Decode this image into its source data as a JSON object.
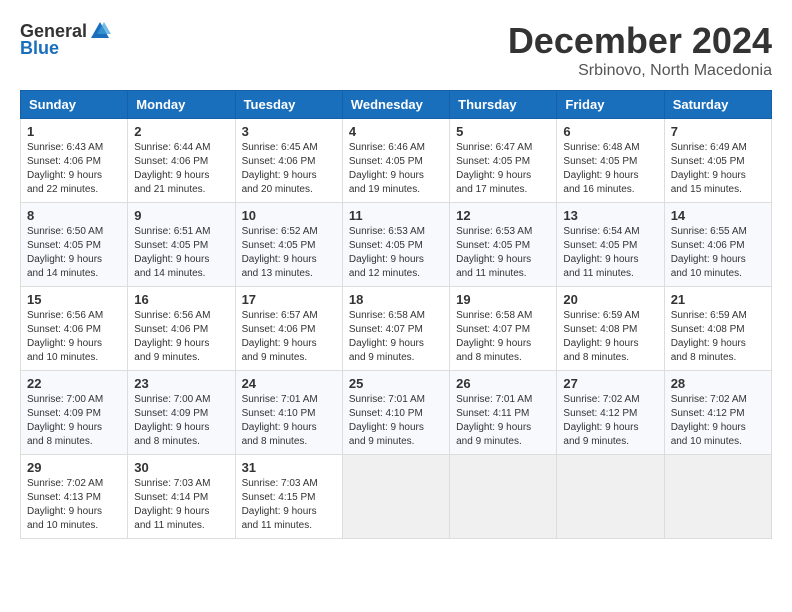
{
  "header": {
    "logo_general": "General",
    "logo_blue": "Blue",
    "month_title": "December 2024",
    "subtitle": "Srbinovo, North Macedonia"
  },
  "weekdays": [
    "Sunday",
    "Monday",
    "Tuesday",
    "Wednesday",
    "Thursday",
    "Friday",
    "Saturday"
  ],
  "weeks": [
    [
      {
        "day": "1",
        "sunrise": "Sunrise: 6:43 AM",
        "sunset": "Sunset: 4:06 PM",
        "daylight": "Daylight: 9 hours and 22 minutes."
      },
      {
        "day": "2",
        "sunrise": "Sunrise: 6:44 AM",
        "sunset": "Sunset: 4:06 PM",
        "daylight": "Daylight: 9 hours and 21 minutes."
      },
      {
        "day": "3",
        "sunrise": "Sunrise: 6:45 AM",
        "sunset": "Sunset: 4:06 PM",
        "daylight": "Daylight: 9 hours and 20 minutes."
      },
      {
        "day": "4",
        "sunrise": "Sunrise: 6:46 AM",
        "sunset": "Sunset: 4:05 PM",
        "daylight": "Daylight: 9 hours and 19 minutes."
      },
      {
        "day": "5",
        "sunrise": "Sunrise: 6:47 AM",
        "sunset": "Sunset: 4:05 PM",
        "daylight": "Daylight: 9 hours and 17 minutes."
      },
      {
        "day": "6",
        "sunrise": "Sunrise: 6:48 AM",
        "sunset": "Sunset: 4:05 PM",
        "daylight": "Daylight: 9 hours and 16 minutes."
      },
      {
        "day": "7",
        "sunrise": "Sunrise: 6:49 AM",
        "sunset": "Sunset: 4:05 PM",
        "daylight": "Daylight: 9 hours and 15 minutes."
      }
    ],
    [
      {
        "day": "8",
        "sunrise": "Sunrise: 6:50 AM",
        "sunset": "Sunset: 4:05 PM",
        "daylight": "Daylight: 9 hours and 14 minutes."
      },
      {
        "day": "9",
        "sunrise": "Sunrise: 6:51 AM",
        "sunset": "Sunset: 4:05 PM",
        "daylight": "Daylight: 9 hours and 14 minutes."
      },
      {
        "day": "10",
        "sunrise": "Sunrise: 6:52 AM",
        "sunset": "Sunset: 4:05 PM",
        "daylight": "Daylight: 9 hours and 13 minutes."
      },
      {
        "day": "11",
        "sunrise": "Sunrise: 6:53 AM",
        "sunset": "Sunset: 4:05 PM",
        "daylight": "Daylight: 9 hours and 12 minutes."
      },
      {
        "day": "12",
        "sunrise": "Sunrise: 6:53 AM",
        "sunset": "Sunset: 4:05 PM",
        "daylight": "Daylight: 9 hours and 11 minutes."
      },
      {
        "day": "13",
        "sunrise": "Sunrise: 6:54 AM",
        "sunset": "Sunset: 4:05 PM",
        "daylight": "Daylight: 9 hours and 11 minutes."
      },
      {
        "day": "14",
        "sunrise": "Sunrise: 6:55 AM",
        "sunset": "Sunset: 4:06 PM",
        "daylight": "Daylight: 9 hours and 10 minutes."
      }
    ],
    [
      {
        "day": "15",
        "sunrise": "Sunrise: 6:56 AM",
        "sunset": "Sunset: 4:06 PM",
        "daylight": "Daylight: 9 hours and 10 minutes."
      },
      {
        "day": "16",
        "sunrise": "Sunrise: 6:56 AM",
        "sunset": "Sunset: 4:06 PM",
        "daylight": "Daylight: 9 hours and 9 minutes."
      },
      {
        "day": "17",
        "sunrise": "Sunrise: 6:57 AM",
        "sunset": "Sunset: 4:06 PM",
        "daylight": "Daylight: 9 hours and 9 minutes."
      },
      {
        "day": "18",
        "sunrise": "Sunrise: 6:58 AM",
        "sunset": "Sunset: 4:07 PM",
        "daylight": "Daylight: 9 hours and 9 minutes."
      },
      {
        "day": "19",
        "sunrise": "Sunrise: 6:58 AM",
        "sunset": "Sunset: 4:07 PM",
        "daylight": "Daylight: 9 hours and 8 minutes."
      },
      {
        "day": "20",
        "sunrise": "Sunrise: 6:59 AM",
        "sunset": "Sunset: 4:08 PM",
        "daylight": "Daylight: 9 hours and 8 minutes."
      },
      {
        "day": "21",
        "sunrise": "Sunrise: 6:59 AM",
        "sunset": "Sunset: 4:08 PM",
        "daylight": "Daylight: 9 hours and 8 minutes."
      }
    ],
    [
      {
        "day": "22",
        "sunrise": "Sunrise: 7:00 AM",
        "sunset": "Sunset: 4:09 PM",
        "daylight": "Daylight: 9 hours and 8 minutes."
      },
      {
        "day": "23",
        "sunrise": "Sunrise: 7:00 AM",
        "sunset": "Sunset: 4:09 PM",
        "daylight": "Daylight: 9 hours and 8 minutes."
      },
      {
        "day": "24",
        "sunrise": "Sunrise: 7:01 AM",
        "sunset": "Sunset: 4:10 PM",
        "daylight": "Daylight: 9 hours and 8 minutes."
      },
      {
        "day": "25",
        "sunrise": "Sunrise: 7:01 AM",
        "sunset": "Sunset: 4:10 PM",
        "daylight": "Daylight: 9 hours and 9 minutes."
      },
      {
        "day": "26",
        "sunrise": "Sunrise: 7:01 AM",
        "sunset": "Sunset: 4:11 PM",
        "daylight": "Daylight: 9 hours and 9 minutes."
      },
      {
        "day": "27",
        "sunrise": "Sunrise: 7:02 AM",
        "sunset": "Sunset: 4:12 PM",
        "daylight": "Daylight: 9 hours and 9 minutes."
      },
      {
        "day": "28",
        "sunrise": "Sunrise: 7:02 AM",
        "sunset": "Sunset: 4:12 PM",
        "daylight": "Daylight: 9 hours and 10 minutes."
      }
    ],
    [
      {
        "day": "29",
        "sunrise": "Sunrise: 7:02 AM",
        "sunset": "Sunset: 4:13 PM",
        "daylight": "Daylight: 9 hours and 10 minutes."
      },
      {
        "day": "30",
        "sunrise": "Sunrise: 7:03 AM",
        "sunset": "Sunset: 4:14 PM",
        "daylight": "Daylight: 9 hours and 11 minutes."
      },
      {
        "day": "31",
        "sunrise": "Sunrise: 7:03 AM",
        "sunset": "Sunset: 4:15 PM",
        "daylight": "Daylight: 9 hours and 11 minutes."
      },
      null,
      null,
      null,
      null
    ]
  ]
}
